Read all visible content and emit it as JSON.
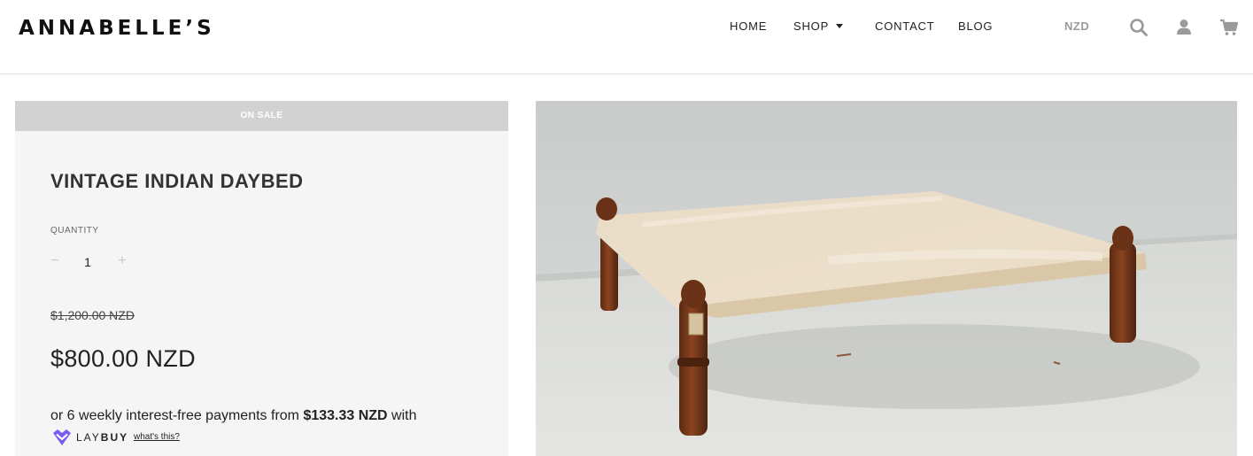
{
  "header": {
    "logo": "ANNABELLE’S",
    "nav": {
      "home": "HOME",
      "shop": "SHOP",
      "contact": "CONTACT",
      "blog": "BLOG"
    },
    "currency": "NZD",
    "icons": [
      "search-icon",
      "user-icon",
      "cart-icon"
    ]
  },
  "product": {
    "badge": "ON SALE",
    "title": "VINTAGE INDIAN DAYBED",
    "quantity_label": "QUANTITY",
    "quantity_minus": "−",
    "quantity_value": "1",
    "quantity_plus": "+",
    "compare_price": "$1,200.00 NZD",
    "price": "$800.00 NZD",
    "laybuy": {
      "text_before": "or 6 weekly interest-free payments from ",
      "amount": "$133.33 NZD",
      "text_after": " with",
      "brand_light": "LAY",
      "brand_bold": "BUY",
      "whats_this": "what's this?"
    }
  },
  "colors": {
    "sale_bar": "#d2d2d2",
    "panel_bg": "#f5f5f5",
    "laybuy_purple": "#7b5cf0",
    "icon_grey": "#9a9a9a"
  }
}
